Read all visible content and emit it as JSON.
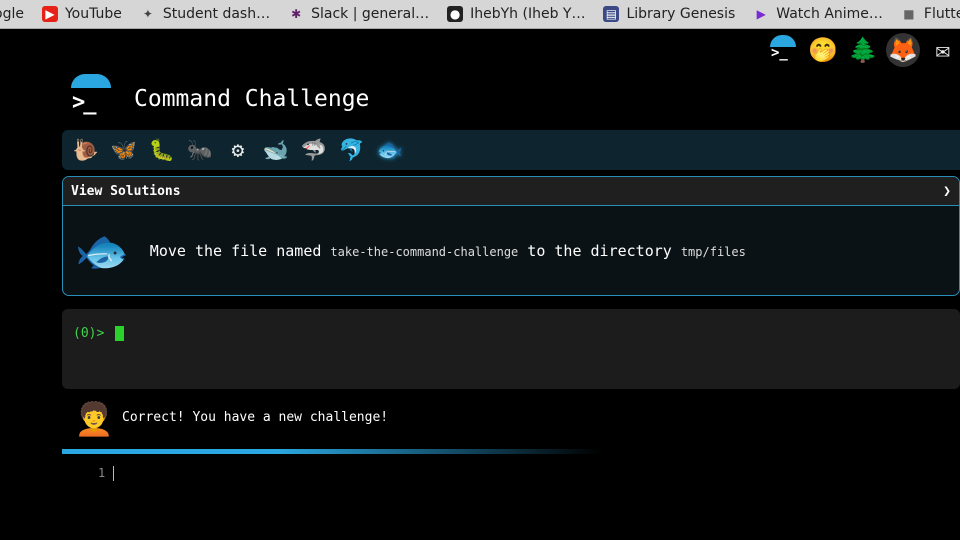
{
  "bookmarks": [
    {
      "label": "ogle",
      "icon": "generic-icon"
    },
    {
      "label": "YouTube",
      "icon": "youtube-icon"
    },
    {
      "label": "Student dash…",
      "icon": "student-icon"
    },
    {
      "label": "Slack | general…",
      "icon": "slack-icon"
    },
    {
      "label": "IhebYh (Iheb Y…",
      "icon": "github-icon"
    },
    {
      "label": "Library Genesis",
      "icon": "library-icon"
    },
    {
      "label": "Watch Anime…",
      "icon": "play-icon"
    },
    {
      "label": "Flutter",
      "icon": "folder-icon"
    }
  ],
  "header": {
    "title": "Command Challenge",
    "logo_glyph": ">_"
  },
  "top_icons": [
    "logo-icon",
    "hand-over-mouth-icon",
    "tree-icon",
    "gitlab-fox-icon",
    "envelope-icon"
  ],
  "levels": [
    {
      "name": "snail-icon",
      "glyph": "🐌"
    },
    {
      "name": "butterfly-icon",
      "glyph": "🦋"
    },
    {
      "name": "caterpillar-icon",
      "glyph": "🐛"
    },
    {
      "name": "ant-icon",
      "glyph": "🐜"
    },
    {
      "name": "circle-icon",
      "glyph": "⚙"
    },
    {
      "name": "whale-icon",
      "glyph": "🐋"
    },
    {
      "name": "shark-icon",
      "glyph": "🦈"
    },
    {
      "name": "dolphin-icon",
      "glyph": "🐬"
    },
    {
      "name": "fish-icon",
      "glyph": "🐟"
    }
  ],
  "challenge": {
    "header": "View Solutions",
    "chevron": "❯",
    "instruction_1": "Move the file named ",
    "file": "take-the-command-challenge",
    "instruction_2": " to the directory ",
    "dir": "tmp/files",
    "icon": "🐟"
  },
  "terminal": {
    "prompt": "(0)>"
  },
  "feedback": {
    "avatar": "🧑‍🦱",
    "message": "Correct! You have a new challenge!"
  },
  "editor": {
    "line_number": "1"
  },
  "colors": {
    "accent": "#2aa7e0",
    "prompt": "#3ed34a",
    "background": "#000000"
  }
}
